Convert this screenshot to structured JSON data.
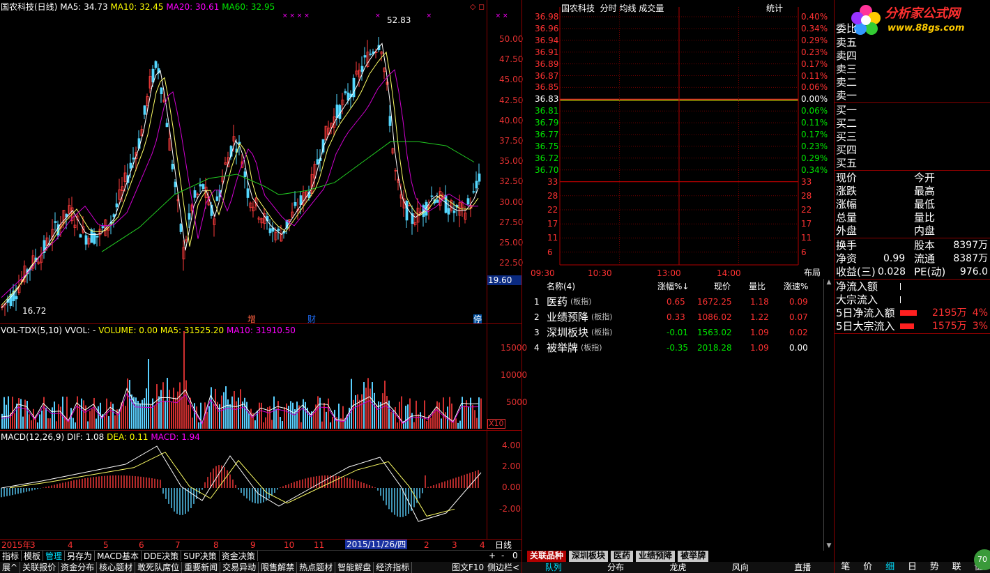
{
  "kline": {
    "title": "国农科技(日线)",
    "ma5": "MA5: 34.73",
    "ma10": "MA10: 32.45",
    "ma20": "MA20: 30.61",
    "ma60": "MA60: 32.95",
    "high_label": "52.83",
    "low_label": "16.72",
    "price_ticks": [
      "50.00",
      "47.50",
      "45.00",
      "42.50",
      "40.00",
      "37.50",
      "35.00",
      "32.50",
      "30.00",
      "27.50",
      "25.00",
      "22.50"
    ],
    "current_price": "19.60",
    "marks": [
      "增",
      "财",
      "停"
    ]
  },
  "vol": {
    "title": "VOL-TDX(5,10) VVOL: -",
    "volume": "VOLUME: 0.00",
    "ma5": "MA5: 31525.20",
    "ma10": "MA10: 31910.50",
    "ticks": [
      "15000",
      "10000",
      "5000"
    ],
    "unit": "X10"
  },
  "macd": {
    "title": "MACD(12,26,9)",
    "dif": "DIF: 1.08",
    "dea": "DEA: 0.11",
    "macd": "MACD: 1.94",
    "ticks": [
      "4.00",
      "2.00",
      "0.00",
      "-2.00"
    ]
  },
  "dates": {
    "labels": [
      "2015年",
      "3",
      "4",
      "5",
      "6",
      "7",
      "8",
      "9",
      "10",
      "11",
      "2015/11/26/四",
      "2",
      "3",
      "4"
    ],
    "period": "日线",
    "plus": "+",
    "minus": "-",
    "zero": "0"
  },
  "bottom_tabs": [
    "指标",
    "模板",
    "管理",
    "另存为",
    "MACD基本",
    "DDE决策",
    "SUP决策",
    "资金决策"
  ],
  "func_bar": [
    "展^",
    "关联报价",
    "资金分布",
    "核心题材",
    "敢死队席位",
    "重要新闻",
    "交易异动",
    "限售解禁",
    "热点题材",
    "智能解盘",
    "经济指标"
  ],
  "func_bar_right": [
    "图文F10",
    "侧边栏<"
  ],
  "intraday": {
    "title": "国农科技",
    "fenshi": "分时",
    "junxian": "均线",
    "chengjiao": "成交量",
    "tongji": "统计",
    "left_ticks_red": [
      "36.98",
      "36.96",
      "36.94",
      "36.91",
      "36.89",
      "36.87",
      "36.85"
    ],
    "left_mid": "36.83",
    "left_ticks_green": [
      "36.81",
      "36.79",
      "36.77",
      "36.75",
      "36.72",
      "36.70"
    ],
    "right_ticks_red": [
      "0.40%",
      "0.34%",
      "0.29%",
      "0.23%",
      "0.17%",
      "0.11%",
      "0.06%"
    ],
    "right_mid": "0.00%",
    "right_ticks_green": [
      "0.06%",
      "0.11%",
      "0.17%",
      "0.23%",
      "0.29%",
      "0.34%"
    ],
    "vol_ticks": [
      "33",
      "28",
      "22",
      "17",
      "11",
      "6"
    ],
    "times": [
      "09:30",
      "10:30",
      "13:00",
      "14:00"
    ],
    "layout_btn": "布局"
  },
  "related": {
    "headers": [
      "名称(4)",
      "涨幅%↓",
      "现价",
      "量比",
      "涨速%"
    ],
    "rows": [
      {
        "idx": "1",
        "name": "医药",
        "tag": "(板指)",
        "chg": "0.65",
        "price": "1672.25",
        "vr": "1.18",
        "speed": "0.09",
        "up": true
      },
      {
        "idx": "2",
        "name": "业绩预降",
        "tag": "(板指)",
        "chg": "0.33",
        "price": "1086.02",
        "vr": "1.22",
        "speed": "0.07",
        "up": true
      },
      {
        "idx": "3",
        "name": "深圳板块",
        "tag": "(板指)",
        "chg": "-0.01",
        "price": "1563.02",
        "vr": "1.09",
        "speed": "0.02",
        "up": false
      },
      {
        "idx": "4",
        "name": "被举牌",
        "tag": "(板指)",
        "chg": "-0.35",
        "price": "2018.28",
        "vr": "1.09",
        "speed": "0.00",
        "up": false
      }
    ]
  },
  "mid_tabs": [
    "关联品种",
    "深圳板块",
    "医药",
    "业绩预降",
    "被举牌"
  ],
  "mid_bottom": [
    "队列",
    "分布",
    "龙虎",
    "风向",
    "直播"
  ],
  "orderbook": {
    "wei": "委比",
    "sells": [
      "卖五",
      "卖四",
      "卖三",
      "卖二",
      "卖一"
    ],
    "buys": [
      "买一",
      "买二",
      "买三",
      "买四",
      "买五"
    ]
  },
  "quote": {
    "left": [
      "现价",
      "涨跌",
      "涨幅",
      "总量",
      "外盘"
    ],
    "right": [
      "今开",
      "最高",
      "最低",
      "量比",
      "内盘"
    ]
  },
  "fund": {
    "huanshou": "换手",
    "guben": "股本",
    "guben_v": "8397万",
    "jingzi": "净资",
    "jingzi_v": "0.99",
    "liutong": "流通",
    "liutong_v": "8387万",
    "shouyi": "收益(三)",
    "shouyi_v": "0.028",
    "pe": "PE(动)",
    "pe_v": "976.0"
  },
  "flow": {
    "net_in": "净流入额",
    "block_in": "大宗流入",
    "net5": "5日净流入额",
    "net5_v": "2195万",
    "net5_p": "4%",
    "block5": "5日大宗流入",
    "block5_v": "1575万",
    "block5_p": "3%"
  },
  "right_bottom": [
    "笔",
    "价",
    "细",
    "日",
    "势",
    "联",
    "值"
  ],
  "logo": {
    "name": "分析家公式网",
    "url": "www.88gs.com",
    "badge": "70"
  }
}
